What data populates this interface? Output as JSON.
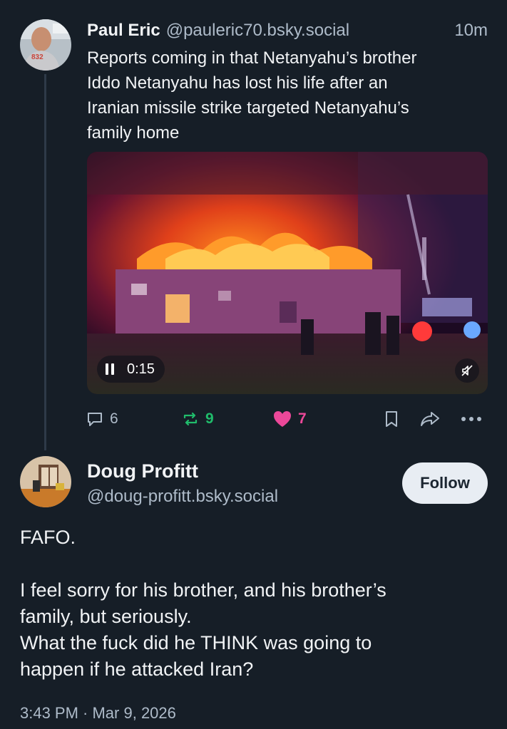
{
  "post1": {
    "author_name": "Paul Eric",
    "author_handle": "@pauleric70.bsky.social",
    "time": "10m",
    "lines": [
      "Reports coming in that Netanyahu’s brother",
      "Iddo Netanyahu has lost his life after an",
      "Iranian missile strike targeted Netanyahu’s",
      "family home"
    ],
    "video": {
      "timestamp": "0:15",
      "controls": {
        "play_state_icon": "pause-icon",
        "mute_icon": "muted-speaker-icon"
      }
    },
    "actions": {
      "replies": "6",
      "reposts": "9",
      "likes": "7"
    }
  },
  "post2": {
    "author_name": "Doug Profitt",
    "author_handle": "@doug-profitt.bsky.social",
    "follow_label": "Follow",
    "paragraphs": [
      "FAFO.",
      "",
      "I feel sorry for his brother, and his brother’s",
      "family, but seriously.",
      "What the fuck did he THINK was going to",
      "happen if he attacked Iran?"
    ],
    "timestamp": "3:43 PM · Mar 9, 2026"
  },
  "colors": {
    "background": "#161e27",
    "muted_text": "#aebbc9",
    "repost_green": "#20bc6b",
    "like_pink": "#ec4899",
    "follow_bg": "#e8edf3"
  }
}
